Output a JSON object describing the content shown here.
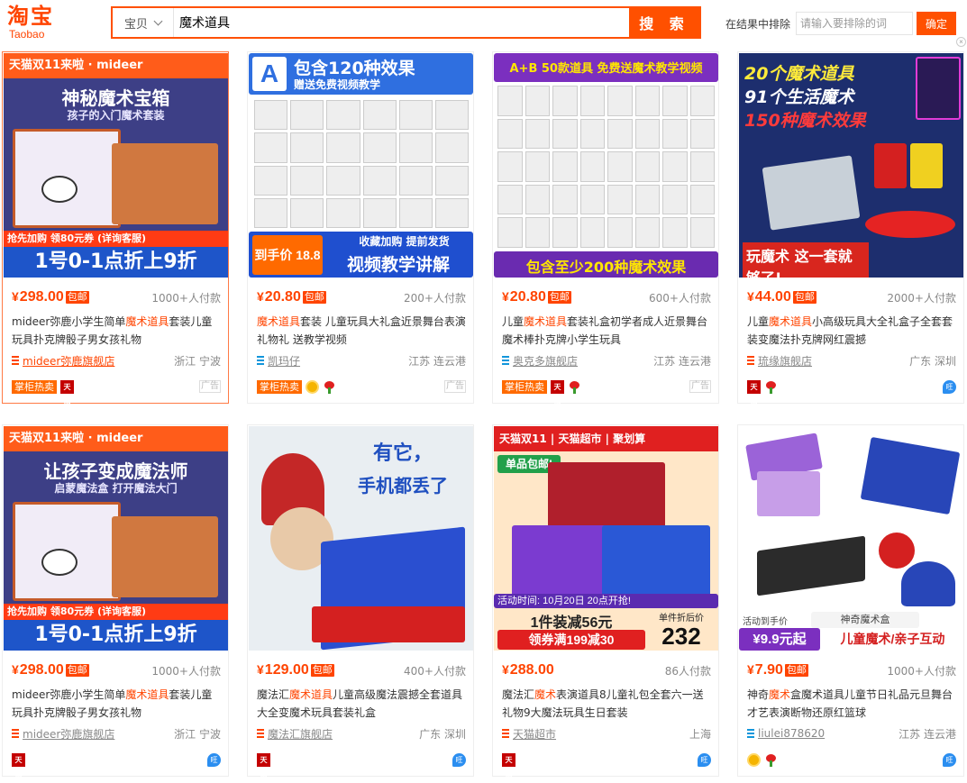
{
  "header": {
    "logo_cn": "淘宝",
    "logo_en": "Taobao",
    "search_type": "宝贝",
    "search_query": "魔术道具",
    "search_button": "搜 索",
    "exclude_label": "在结果中排除",
    "exclude_placeholder": "请输入要排除的词",
    "exclude_confirm": "确定"
  },
  "products": [
    {
      "price": "298.00",
      "baoyou": "包邮",
      "deals": "1000+人付款",
      "title_parts": [
        "mideer弥鹿小学生简单",
        "魔术道具",
        "套装儿童玩具扑克牌骰子男女孩礼物"
      ],
      "shop": "mideer弥鹿旗舰店",
      "location": "浙江 宁波",
      "hot_tag": "掌柜热卖",
      "ad": "广告",
      "img": {
        "top": "天猫双11来啦 · mideer",
        "headline": "神秘魔术宝箱",
        "sub": "孩子的入门魔术套装",
        "coupon": "抢先加购 领80元券 (详询客服)",
        "bottom": "1号0-1点折上9折"
      }
    },
    {
      "price": "20.80",
      "baoyou": "包邮",
      "deals": "200+人付款",
      "title_parts": [
        "",
        "魔术道具",
        "套装 儿童玩具大礼盒近景舞台表演礼物礼 送教学视频"
      ],
      "shop": "凯玛仔",
      "location": "江苏 连云港",
      "hot_tag": "掌柜热卖",
      "ad": "广告",
      "img": {
        "headline": "包含120种效果",
        "sub": "赠送免费视频教学",
        "price": "到手价 18.8元",
        "bottom": "视频教学讲解",
        "mid": "收藏加购 提前发货"
      }
    },
    {
      "price": "20.80",
      "baoyou": "包邮",
      "deals": "600+人付款",
      "title_parts": [
        "儿童",
        "魔术道具",
        "套装礼盒初学者成人近景舞台魔术棒扑克牌小学生玩具"
      ],
      "shop": "奥克多旗舰店",
      "location": "江苏 连云港",
      "hot_tag": "掌柜热卖",
      "ad": "广告",
      "img": {
        "headline": "A+B 50款道具 免费送魔术教学视频",
        "bottom": "包含至少200种魔术效果"
      }
    },
    {
      "price": "44.00",
      "baoyou": "包邮",
      "deals": "2000+人付款",
      "title_parts": [
        "儿童",
        "魔术道具",
        "小高级玩具大全礼盒子全套套装变魔法扑克牌网红震撼"
      ],
      "shop": "琉缘旗舰店",
      "location": "广东 深圳",
      "img": {
        "line1": "20个魔术道具",
        "line2": "91个生活魔术",
        "line3": "150种魔术效果",
        "bottom": "玩魔术 这一套就够了!"
      }
    },
    {
      "price": "298.00",
      "baoyou": "包邮",
      "deals": "1000+人付款",
      "title_parts": [
        "mideer弥鹿小学生简单",
        "魔术道具",
        "套装儿童玩具扑克牌骰子男女孩礼物"
      ],
      "shop": "mideer弥鹿旗舰店",
      "location": "浙江 宁波",
      "hot_tag": "掌柜热卖",
      "img": {
        "top": "天猫双11来啦 · mideer",
        "headline": "让孩子变成魔法师",
        "sub": "启蒙魔法盒 打开魔法大门",
        "coupon": "抢先加购 领80元券 (详询客服)",
        "bottom": "1号0-1点折上9折"
      }
    },
    {
      "price": "129.00",
      "baoyou": "包邮",
      "deals": "400+人付款",
      "title_parts": [
        "魔法汇",
        "魔术道具",
        "儿童高级魔法震撼全套道具大全变魔术玩具套装礼盒"
      ],
      "shop": "魔法汇旗舰店",
      "location": "广东 深圳",
      "img": {
        "headline": "有它，",
        "sub": "手机都丢了"
      }
    },
    {
      "price": "288.00",
      "deals": "86人付款",
      "title_parts": [
        "魔法汇",
        "魔术",
        "表演道具8儿童礼包全套六一送礼物9大魔法玩具生日套装"
      ],
      "shop": "天猫超市",
      "location": "上海",
      "img": {
        "top": "天猫双11 | 天猫超市 | 聚划算",
        "tag": "单品包邮!",
        "date": "活动时间: 10月20日 20点开抢!",
        "deal": "1件装减56元",
        "coupon": "领券满199减30",
        "after_label": "单件折后价",
        "after_price": "232"
      }
    },
    {
      "price": "7.90",
      "baoyou": "包邮",
      "deals": "1000+人付款",
      "title_parts": [
        "神奇",
        "魔术",
        "盒魔术道具儿童节日礼品元旦舞台才艺表演断物还原红篮球"
      ],
      "shop": "liulei878620",
      "location": "江苏 连云港",
      "img": {
        "box_label": "神奇魔术盒",
        "price_tag": "活动到手价",
        "price": "¥9.9元起",
        "bottom": "儿童魔术/亲子互动"
      }
    }
  ],
  "colors": {
    "accent": "#ff5000",
    "price": "#ff4400",
    "blue": "#1e55c9"
  }
}
